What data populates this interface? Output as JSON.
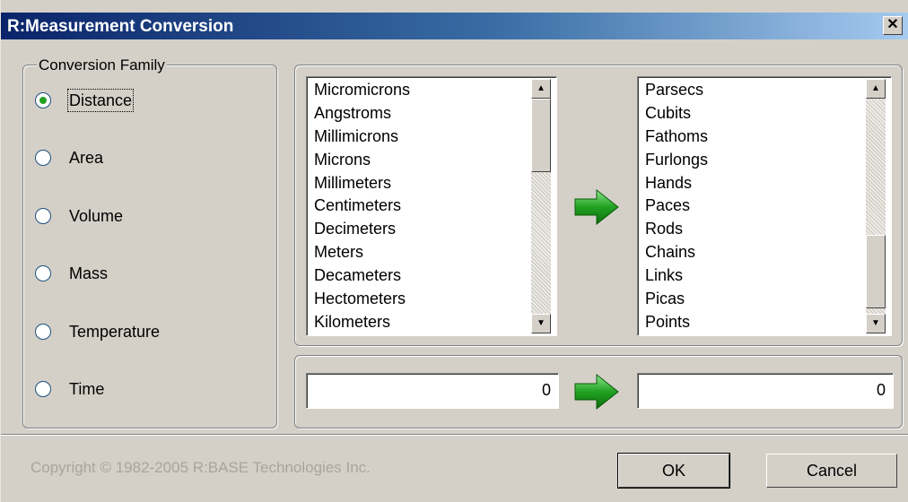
{
  "window": {
    "title": "R:Measurement Conversion",
    "close_label": "✕"
  },
  "family": {
    "legend": "Conversion Family",
    "options": [
      {
        "label": "Distance",
        "selected": true
      },
      {
        "label": "Area",
        "selected": false
      },
      {
        "label": "Volume",
        "selected": false
      },
      {
        "label": "Mass",
        "selected": false
      },
      {
        "label": "Temperature",
        "selected": false
      },
      {
        "label": "Time",
        "selected": false
      }
    ]
  },
  "from_list": {
    "items": [
      "Micromicrons",
      "Angstroms",
      "Millimicrons",
      "Microns",
      "Millimeters",
      "Centimeters",
      "Decimeters",
      "Meters",
      "Decameters",
      "Hectometers",
      "Kilometers"
    ]
  },
  "to_list": {
    "items": [
      "Parsecs",
      "Cubits",
      "Fathoms",
      "Furlongs",
      "Hands",
      "Paces",
      "Rods",
      "Chains",
      "Links",
      "Picas",
      "Points"
    ]
  },
  "input": {
    "from_value": "0",
    "to_value": "0"
  },
  "footer": {
    "copyright": "Copyright © 1982-2005 R:BASE Technologies Inc.",
    "ok_label": "OK",
    "cancel_label": "Cancel"
  },
  "icons": {
    "arrow": "green-right-arrow-icon",
    "arrow_color": "#21a121"
  }
}
